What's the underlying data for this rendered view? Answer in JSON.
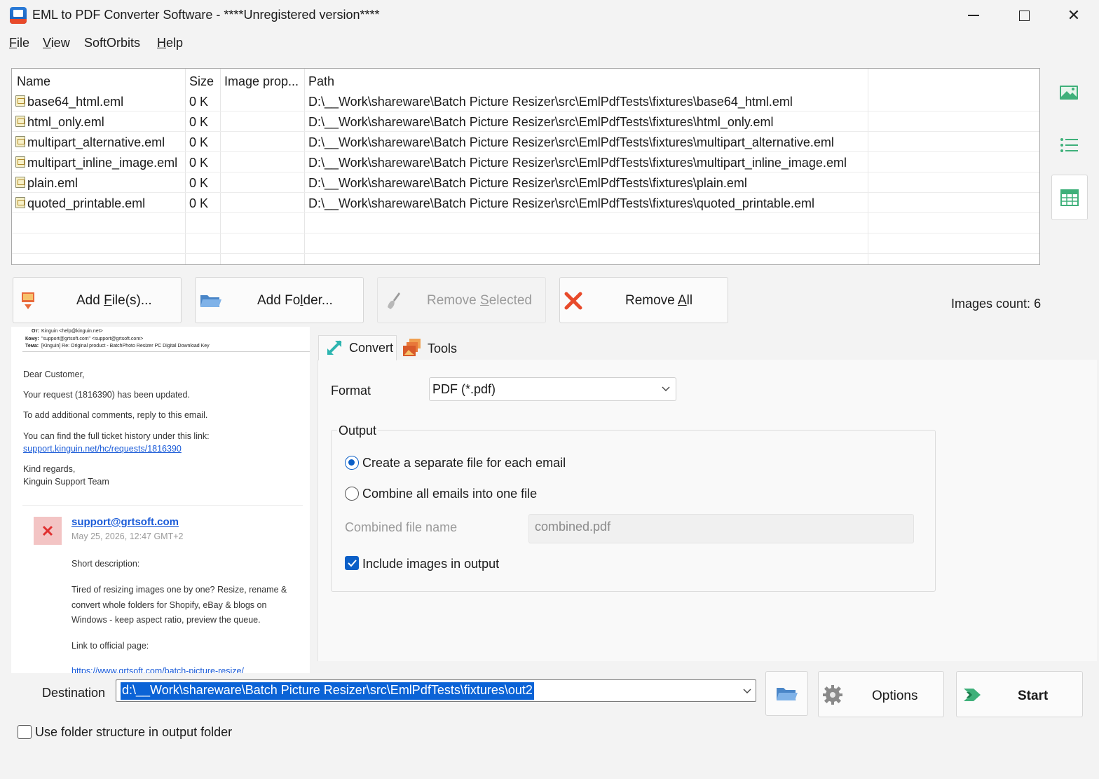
{
  "window": {
    "title": "EML to PDF Converter Software - ****Unregistered version****",
    "close_glyph": "✕"
  },
  "menu": {
    "items": [
      {
        "prefix": "",
        "key": "F",
        "rest": "ile"
      },
      {
        "prefix": "",
        "key": "V",
        "rest": "iew"
      },
      {
        "prefix": "SoftOrbits",
        "key": "",
        "rest": ""
      },
      {
        "prefix": "",
        "key": "H",
        "rest": "elp"
      }
    ]
  },
  "file_list": {
    "columns": [
      "Name",
      "Size",
      "Image prop...",
      "Path"
    ],
    "rows": [
      {
        "name": "base64_html.eml",
        "size": "0 K",
        "props": "",
        "path": "D:\\__Work\\shareware\\Batch Picture Resizer\\src\\EmlPdfTests\\fixtures\\base64_html.eml"
      },
      {
        "name": "html_only.eml",
        "size": "0 K",
        "props": "",
        "path": "D:\\__Work\\shareware\\Batch Picture Resizer\\src\\EmlPdfTests\\fixtures\\html_only.eml"
      },
      {
        "name": "multipart_alternative.eml",
        "size": "0 K",
        "props": "",
        "path": "D:\\__Work\\shareware\\Batch Picture Resizer\\src\\EmlPdfTests\\fixtures\\multipart_alternative.eml"
      },
      {
        "name": "multipart_inline_image.eml",
        "size": "0 K",
        "props": "",
        "path": "D:\\__Work\\shareware\\Batch Picture Resizer\\src\\EmlPdfTests\\fixtures\\multipart_inline_image.eml"
      },
      {
        "name": "plain.eml",
        "size": "0 K",
        "props": "",
        "path": "D:\\__Work\\shareware\\Batch Picture Resizer\\src\\EmlPdfTests\\fixtures\\plain.eml"
      },
      {
        "name": "quoted_printable.eml",
        "size": "0 K",
        "props": "",
        "path": "D:\\__Work\\shareware\\Batch Picture Resizer\\src\\EmlPdfTests\\fixtures\\quoted_printable.eml"
      }
    ]
  },
  "toolbar": {
    "add_files": {
      "pre": "Add ",
      "key": "F",
      "post": "ile(s)..."
    },
    "add_folder": {
      "pre": "Add Fo",
      "key": "l",
      "post": "der..."
    },
    "remove_selected": {
      "pre": "Remove ",
      "key": "S",
      "post": "elected"
    },
    "remove_all": {
      "pre": "Remove ",
      "key": "A",
      "post": "ll"
    },
    "images_count": "Images count: 6"
  },
  "preview": {
    "from_label": "От:",
    "from_value": "Kinguin <help@kinguin.net>",
    "to_label": "Кому:",
    "to_value": "\"support@grtsoft.com\" <support@grtsoft.com>",
    "subject_label": "Тема:",
    "subject_value": "[Kinguin] Re: Original product - BatchPhoto Resizer PC Digital Download Key",
    "greeting": "Dear Customer,",
    "line1": "Your request (1816390) has been updated.",
    "line2": "To add additional comments, reply to this email.",
    "line3": "You can find the full ticket history under this link:",
    "link": "support.kinguin.net/hc/requests/1816390",
    "regards": "Kind regards,",
    "team": "Kinguin Support Team",
    "sender": "support@grtsoft.com",
    "date": "May 25, 2026, 12:47 GMT+2",
    "short_desc": "Short description:",
    "body1": "Tired of resizing images one by one? Resize, rename &",
    "body2": "convert whole folders for Shopify, eBay & blogs on",
    "body3": "Windows - keep aspect ratio, preview the queue.",
    "link_label": "Link to official page:",
    "official_link": "https://www.grtsoft.com/batch-picture-resize/"
  },
  "tabs": {
    "convert": "Convert",
    "tools": "Tools"
  },
  "convert": {
    "format_label": "Format",
    "format_value": "PDF (*.pdf)",
    "output_label": "Output",
    "option_separate": "Create a separate file for each email",
    "option_combine": "Combine all emails into one file",
    "combined_label": "Combined file name",
    "combined_value": "combined.pdf",
    "include_images": "Include images in output"
  },
  "destination": {
    "label": "Destination",
    "value": "d:\\__Work\\shareware\\Batch Picture Resizer\\src\\EmlPdfTests\\fixtures\\out2",
    "options_label": "Options",
    "start_label": "Start",
    "use_folder_structure": "Use folder structure in output folder"
  }
}
